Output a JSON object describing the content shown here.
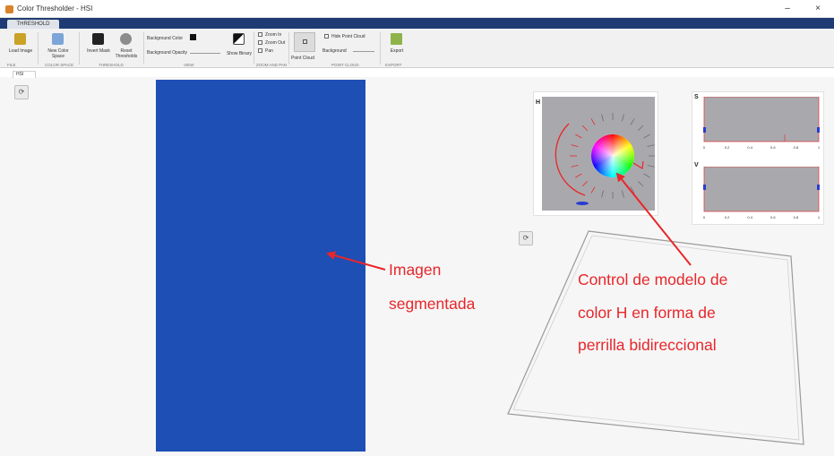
{
  "window": {
    "title": "Color Thresholder - HSI",
    "minimize_glyph": "–",
    "close_glyph": "×"
  },
  "ribbon": {
    "app_tab": "THRESHOLD",
    "buttons": [
      {
        "label": "Load Image",
        "icon": "load-image-icon",
        "color": "#c9a227"
      },
      {
        "label": "New Color Space",
        "icon": "new-color-space-icon",
        "color": "#7da4d6"
      },
      {
        "label": "Invert Mask",
        "icon": "invert-mask-icon",
        "color": "#222222"
      },
      {
        "label": "Reset Thresholds",
        "icon": "reset-icon",
        "color": "#8c8c8c"
      }
    ],
    "background_color_label": "Background Color",
    "background_opacity_label": "Background Opacity",
    "show_binary_label": "Show Binary",
    "zoom_in_label": "Zoom In",
    "zoom_out_label": "Zoom Out",
    "pan_label": "Pan",
    "point_cloud_label": "Point Cloud",
    "hide_point_cloud_label": "Hide Point Cloud",
    "background_label": "Background",
    "export_label": "Export",
    "groups": [
      "FILE",
      "COLOR SPACE",
      "THRESHOLD",
      "VIEW",
      "ZOOM AND PAN",
      "POINT CLOUD",
      "EXPORT"
    ]
  },
  "document": {
    "tab_label": "HSI"
  },
  "panels": {
    "h_label": "H",
    "s_label": "S",
    "v_label": "V",
    "s_ticks": [
      "0",
      "0.2",
      "0.4",
      "0.6",
      "0.8",
      "1"
    ],
    "v_ticks": [
      "0",
      "0.2",
      "0.4",
      "0.6",
      "0.8",
      "1"
    ]
  },
  "annotations": {
    "image_line1": "Imagen",
    "image_line2": "segmentada",
    "control_line1": "Control  de  modelo  de",
    "control_line2": "color  H  en  forma  de",
    "control_line3": "perrilla bidireccional"
  },
  "colors": {
    "annotation": "#e8262a",
    "seg_dark_blue": "#1f4fb4",
    "seg_light_blue": "#5fb8e0",
    "seg_yellow": "#e8d63a",
    "seg_red": "#e2231a",
    "plot_gray": "#a9a9ad",
    "ribbon_blue": "#1f3b73"
  }
}
